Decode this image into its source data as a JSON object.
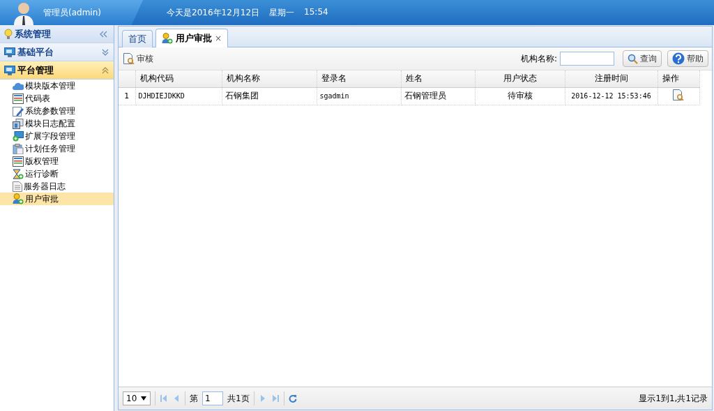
{
  "header": {
    "user_name": "管理员(admin)",
    "date": "今天是2016年12月12日",
    "weekday": "星期一",
    "time": "15:54"
  },
  "sidebar": {
    "sections": [
      {
        "title": "系统管理",
        "kind": "title",
        "expanded": false
      },
      {
        "title": "基础平台",
        "kind": "group",
        "expanded": false
      },
      {
        "title": "平台管理",
        "kind": "group",
        "expanded": true,
        "items": [
          {
            "label": "模块版本管理",
            "selected": false
          },
          {
            "label": "代码表",
            "selected": false
          },
          {
            "label": "系统参数管理",
            "selected": false
          },
          {
            "label": "模块日志配置",
            "selected": false
          },
          {
            "label": "扩展字段管理",
            "selected": false
          },
          {
            "label": "计划任务管理",
            "selected": false
          },
          {
            "label": "版权管理",
            "selected": false
          },
          {
            "label": "运行诊断",
            "selected": false
          },
          {
            "label": "服务器日志",
            "selected": false
          },
          {
            "label": "用户审批",
            "selected": true
          }
        ]
      }
    ]
  },
  "tabs": [
    {
      "label": "首页",
      "selected": false
    },
    {
      "label": "用户审批",
      "selected": true,
      "close": "×"
    }
  ],
  "toolbar": {
    "approve_button": "审核",
    "search_label": "机构名称:",
    "search_button": "查询",
    "help_button": "帮助"
  },
  "table": {
    "columns": [
      "机构代码",
      "机构名称",
      "登录名",
      "姓名",
      "用户状态",
      "注册时间",
      "操作"
    ],
    "rows": [
      {
        "row_number": "1",
        "cells": [
          "DJHDIEJDKKD",
          "石钢集团",
          "sgadmin",
          "石钢管理员",
          "待审核",
          "2016-12-12 15:53:46"
        ]
      }
    ]
  },
  "pager": {
    "page_size": "10",
    "page_prefix": "第",
    "page": "1",
    "page_suffix": "共1页",
    "summary": "显示1到1,共1记录"
  }
}
